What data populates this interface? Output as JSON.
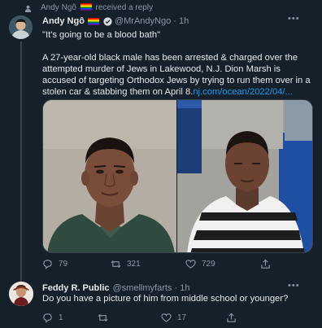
{
  "context": {
    "user": "Andy Ngô",
    "action": "received a reply"
  },
  "tweet": {
    "author_name": "Andy Ngô",
    "handle": "@MrAndyNgo",
    "time": "1h",
    "quote": "\"It's going to be a blood bath\"",
    "body": "A 27-year-old black male has been arrested & charged over the attempted murder of Jews in Lakewood, N.J. Dion Marsh is accused of targeting Orthodox Jews by trying to run them over in a stolen car & stabbing them on April 8.",
    "link": "nj.com/ocean/2022/04/...",
    "replies": "79",
    "retweets": "321",
    "likes": "729"
  },
  "reply": {
    "author_name": "Feddy R. Public",
    "handle": "@smellmyfarts",
    "time": "1h",
    "text": "Do you have a picture of him from middle school or younger?",
    "replies": "1",
    "retweets": "",
    "likes": "17"
  },
  "colors": {
    "background": "#15202b",
    "accent": "#1d9bf0",
    "secondary_text": "#8b98a5",
    "verified": "#1d9bf0"
  },
  "icons": {
    "context": "person-icon",
    "reply": "reply-icon",
    "retweet": "retweet-icon",
    "like": "heart-icon",
    "share": "share-icon",
    "more": "more-icon"
  }
}
